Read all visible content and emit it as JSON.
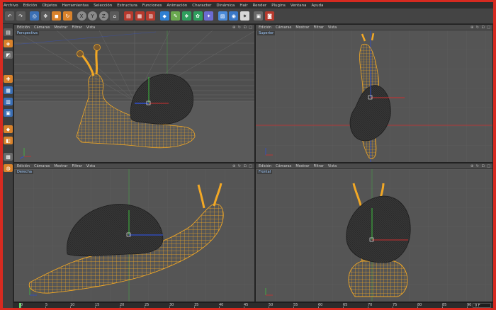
{
  "menu": [
    "Archivo",
    "Edición",
    "Objetos",
    "Herramientas",
    "Selección",
    "Estructura",
    "Funciones",
    "Animación",
    "Character",
    "Dinámica",
    "Hair",
    "Render",
    "Plugins",
    "Ventana",
    "Ayuda"
  ],
  "viewports": [
    {
      "id": "perspectiva",
      "label": "Perspectiva",
      "menus": [
        "Edición",
        "Cámaras",
        "Mostrar",
        "Filtrar",
        "Vista"
      ]
    },
    {
      "id": "superior",
      "label": "Superior",
      "menus": [
        "Edición",
        "Cámaras",
        "Mostrar",
        "Filtrar",
        "Vista"
      ]
    },
    {
      "id": "derecha",
      "label": "Derecha",
      "menus": [
        "Edición",
        "Cámaras",
        "Mostrar",
        "Filtrar",
        "Vista"
      ]
    },
    {
      "id": "frontal",
      "label": "Frontal",
      "menus": [
        "Edición",
        "Cámaras",
        "Mostrar",
        "Filtrar",
        "Vista"
      ]
    }
  ],
  "viewport_controls": "⊕ ↻ ⊡ □",
  "timeline": {
    "ticks": [
      "0",
      "5",
      "10",
      "15",
      "20",
      "25",
      "30",
      "35",
      "40",
      "45",
      "50",
      "55",
      "60",
      "65",
      "70",
      "75",
      "80",
      "85",
      "90"
    ],
    "current_frame": "0 F"
  },
  "colors": {
    "wire": "#f2a825",
    "shell": "#2e2e2e",
    "grid": "#6a6a6a",
    "axis_y": "#3fbf3f",
    "axis_x": "#d03030",
    "axis_z": "#3050d0"
  },
  "icons": {
    "toolbar": [
      "undo-icon",
      "redo-icon",
      "live-select-icon",
      "move-icon",
      "scale-icon",
      "rotate-icon",
      "x-axis-icon",
      "y-axis-icon",
      "z-axis-icon",
      "coordinate-icon",
      "render-view-icon",
      "render-picture-queue-icon",
      "render-settings-icon",
      "cube-icon",
      "pen-icon",
      "subdivision-icon",
      "array-icon",
      "deformer-icon",
      "scene-icon",
      "camera-icon",
      "light-icon",
      "layout-icon",
      "script-icon"
    ],
    "left": [
      "make-editable-icon",
      "model-mode-icon",
      "texture-mode-icon",
      "axis-mode-icon",
      "points-mode-icon",
      "edges-mode-icon",
      "polygons-mode-icon",
      "uv-mode-icon",
      "snap-icon",
      "workplane-icon",
      "sculpt-icon"
    ]
  }
}
